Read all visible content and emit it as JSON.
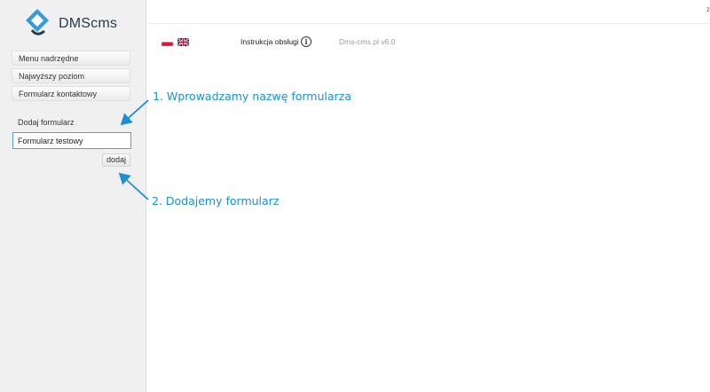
{
  "app": {
    "logo_text": "DMScms",
    "topbar_right": "z"
  },
  "sidebar": {
    "menu": [
      {
        "label": "Menu nadrzędne"
      },
      {
        "label": "Najwyższy poziom"
      },
      {
        "label": "Formularz kontaktowy"
      }
    ],
    "add_form": {
      "section_label": "Dodaj formularz",
      "input_value": "Formularz testowy",
      "button_label": "dodaj"
    }
  },
  "header": {
    "languages": [
      "pl",
      "en"
    ],
    "manual_label": "Instrukcja obsługi",
    "version": "Dms-cms.pl v6.0"
  },
  "annotations": {
    "step1": "1. Wprowadzamy nazwę formularza",
    "step2": "2. Dodajemy formularz"
  },
  "colors": {
    "accent": "#1b8fd0",
    "logo_blue": "#3a9ad9"
  }
}
